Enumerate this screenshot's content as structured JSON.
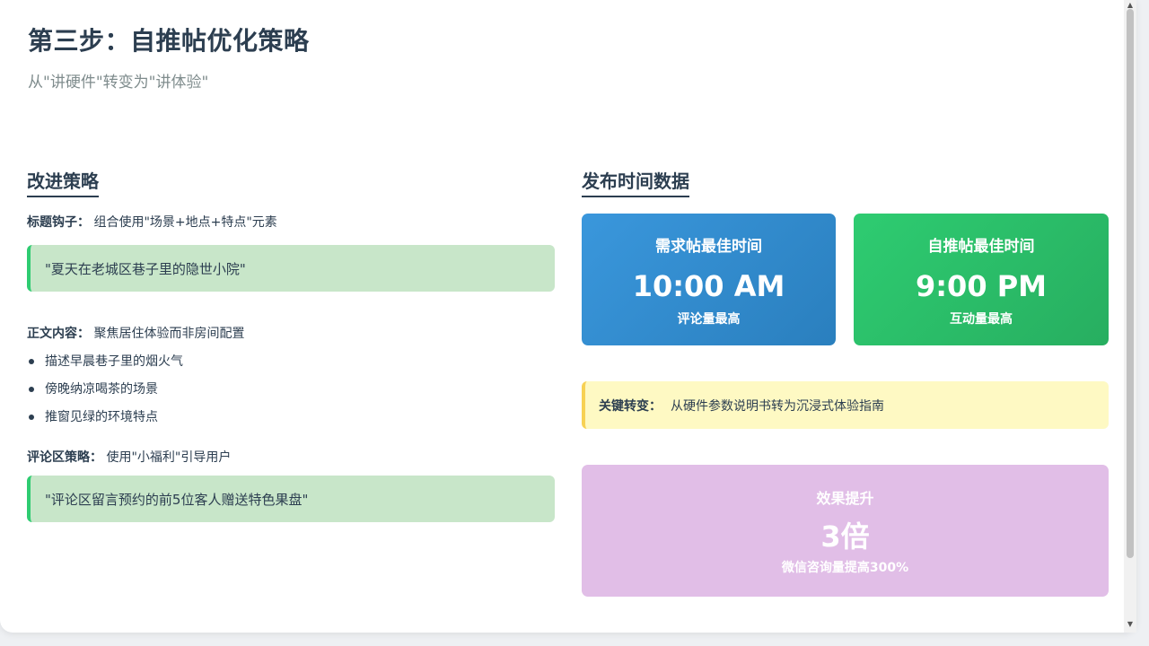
{
  "header": {
    "title": "第三步：自推帖优化策略",
    "subtitle": "从\"讲硬件\"转变为\"讲体验\""
  },
  "strategy": {
    "heading": "改进策略",
    "title_hook": {
      "label": "标题钩子：",
      "text": "组合使用\"场景+地点+特点\"元素",
      "example": "\"夏天在老城区巷子里的隐世小院\""
    },
    "body_content": {
      "label": "正文内容：",
      "text": "聚焦居住体验而非房间配置",
      "bullets": [
        "描述早晨巷子里的烟火气",
        "傍晚纳凉喝茶的场景",
        "推窗见绿的环境特点"
      ]
    },
    "comments": {
      "label": "评论区策略：",
      "text": "使用\"小福利\"引导用户",
      "example": "\"评论区留言预约的前5位客人赠送特色果盘\""
    }
  },
  "timing": {
    "heading": "发布时间数据",
    "demand_card": {
      "label": "需求帖最佳时间",
      "value": "10:00 AM",
      "note": "评论量最高",
      "color": "#3498db"
    },
    "self_card": {
      "label": "自推帖最佳时间",
      "value": "9:00 PM",
      "note": "互动量最高",
      "color": "#2ecc71"
    }
  },
  "key_change": {
    "label": "关键转变：",
    "text": "从硬件参数说明书转为沉浸式体验指南"
  },
  "effect": {
    "label": "效果提升",
    "value": "3倍",
    "note": "微信咨询量提高300%",
    "color": "#e1bee7"
  }
}
